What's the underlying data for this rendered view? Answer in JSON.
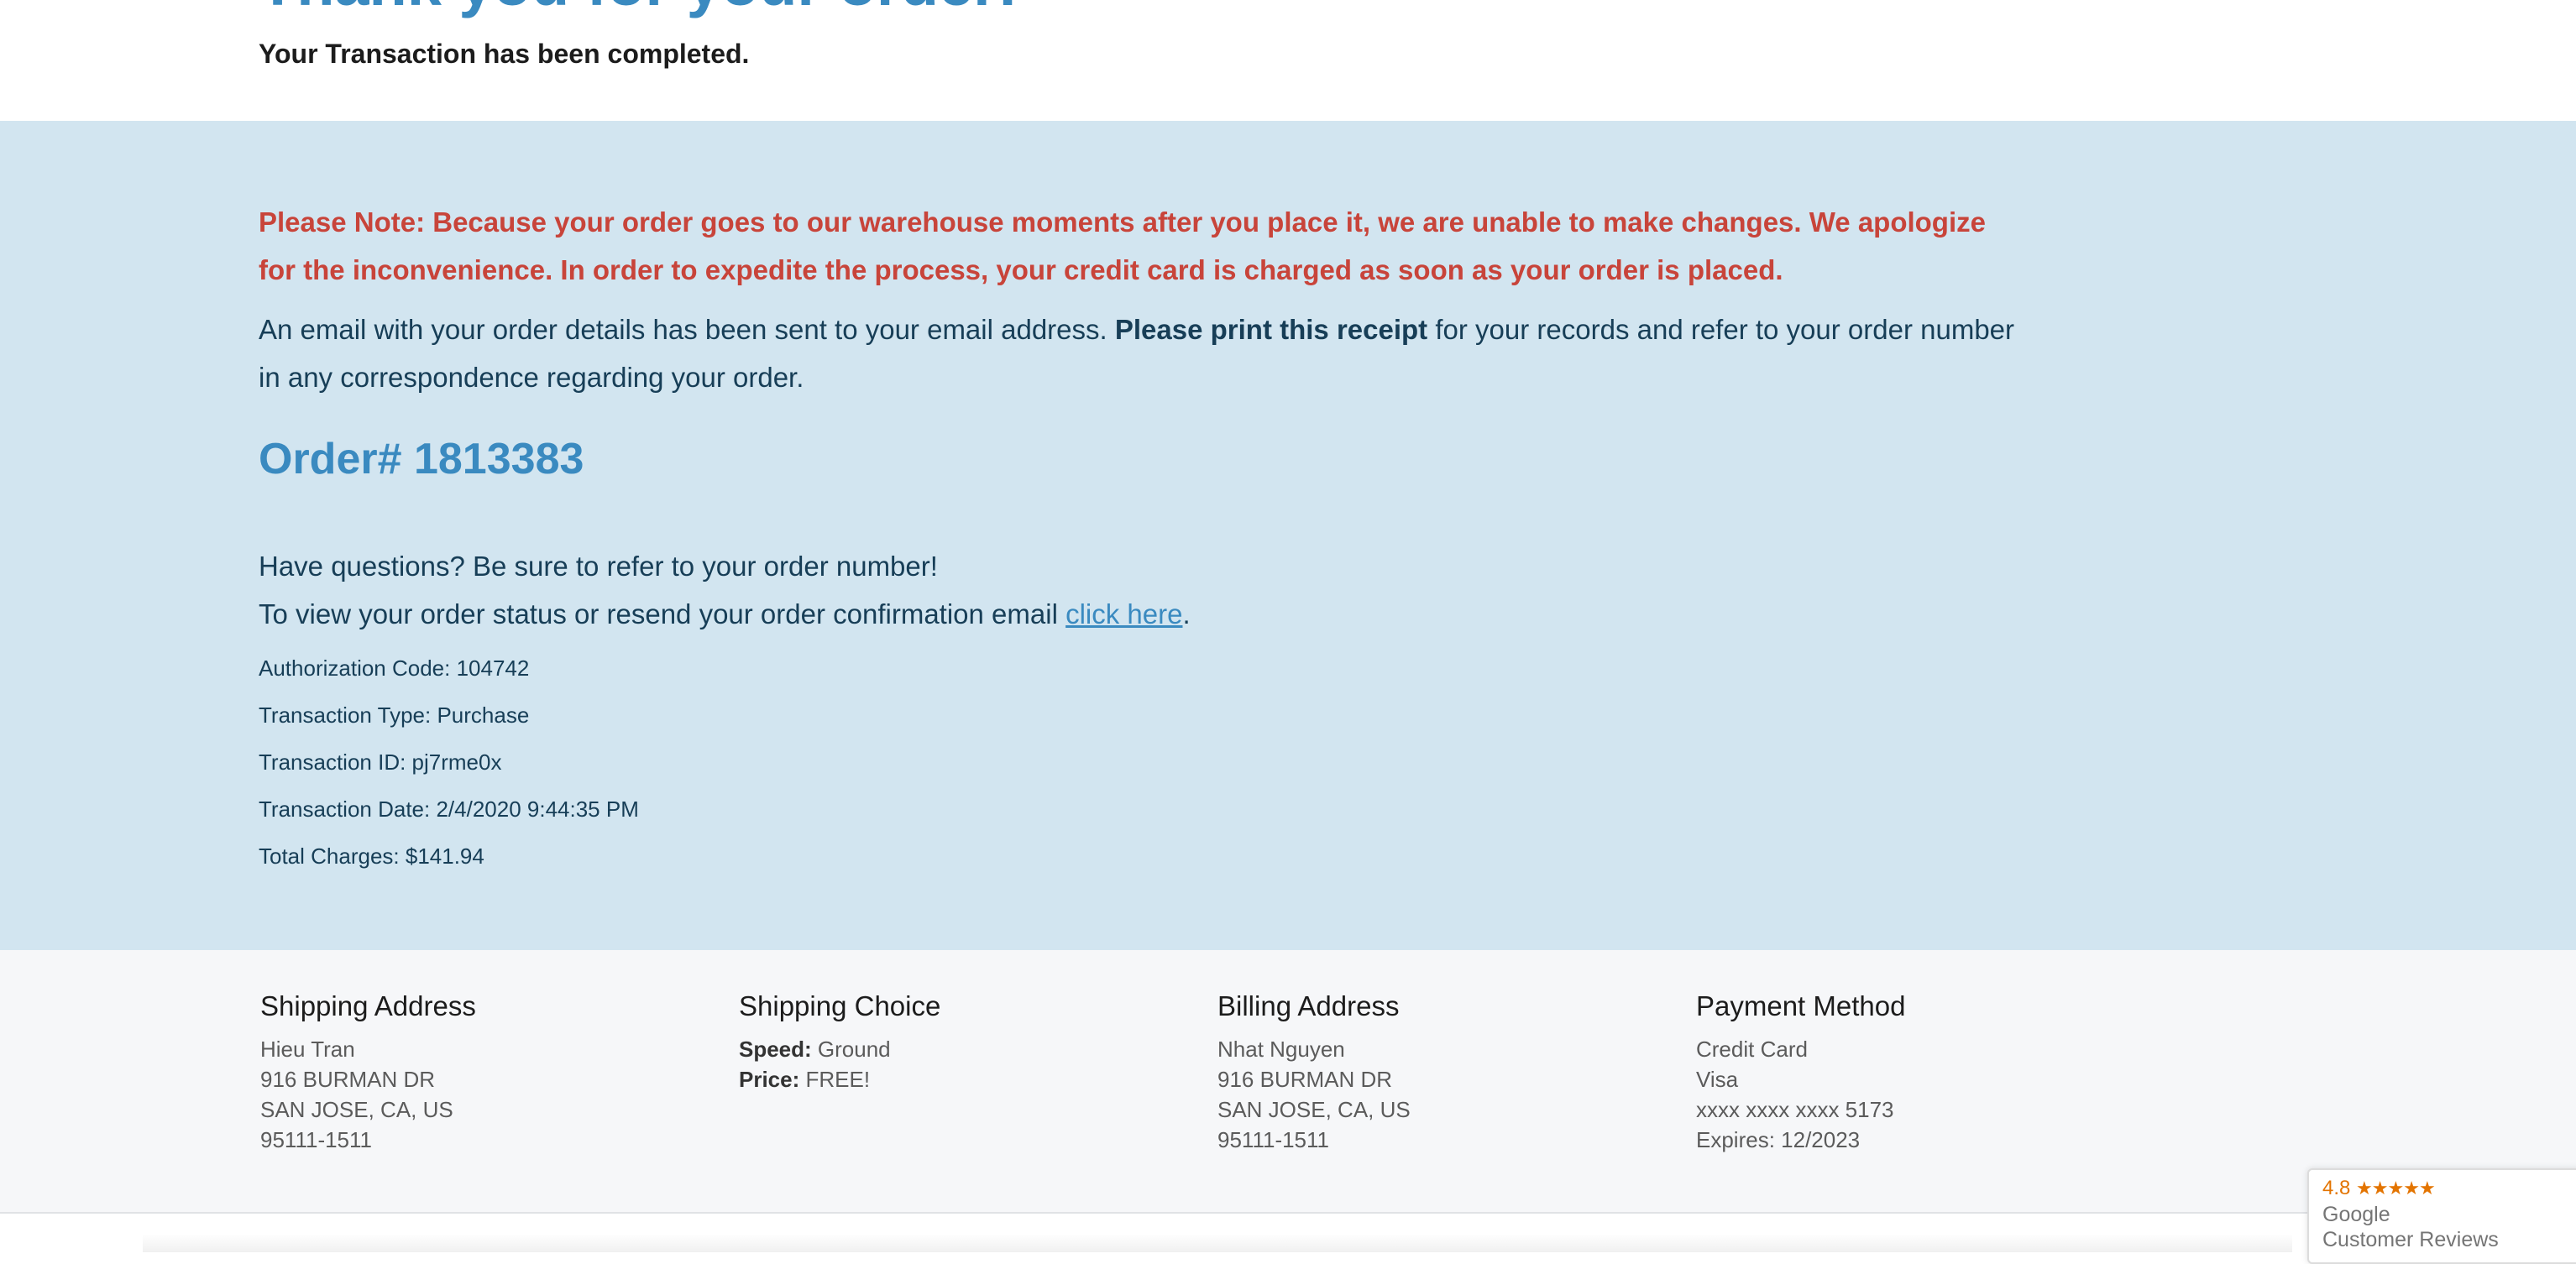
{
  "header": {
    "title": "Thank you for your order!",
    "subtitle": "Your Transaction has been completed."
  },
  "notice": {
    "text": "Please Note: Because your order goes to our warehouse moments after you place it, we are unable to make changes. We apologize for the inconvenience. In order to expedite the process, your credit card is charged as soon as your order is placed."
  },
  "email_message": {
    "part1": "An email with your order details has been sent to your email address.",
    "bold": "Please print this receipt",
    "part2": "for your records and refer to your order number in any correspondence regarding your order."
  },
  "order": {
    "number_label": "Order# 1813383"
  },
  "questions": {
    "line1": "Have questions? Be sure to refer to your order number!",
    "line2_prefix": "To view your order status or resend your order confirmation email",
    "link_label": "click here",
    "line2_suffix": "."
  },
  "transaction": {
    "authorization": "Authorization Code: 104742",
    "type": "Transaction Type: Purchase",
    "id": "Transaction ID: pj7rme0x",
    "date": "Transaction Date: 2/4/2020 9:44:35 PM",
    "total": "Total Charges: $141.94"
  },
  "shipping_address": {
    "heading": "Shipping Address",
    "name": "Hieu Tran",
    "street": "916 BURMAN DR",
    "city": "SAN JOSE, CA, US",
    "zip": "95111-1511"
  },
  "shipping_choice": {
    "heading": "Shipping Choice",
    "speed_label": "Speed:",
    "speed_value": "Ground",
    "price_label": "Price:",
    "price_value": "FREE!"
  },
  "billing_address": {
    "heading": "Billing Address",
    "name": "Nhat Nguyen",
    "street": "916 BURMAN DR",
    "city": "SAN JOSE, CA, US",
    "zip": "95111-1511"
  },
  "payment_method": {
    "heading": "Payment Method",
    "type": "Credit Card",
    "brand": "Visa",
    "card": "xxxx xxxx xxxx 5173",
    "expires": "Expires: 12/2023"
  },
  "reviews_badge": {
    "rating": "4.8",
    "stars": "★★★★★",
    "line1": "Google",
    "line2": "Customer Reviews"
  },
  "colors": {
    "accent": "#3a8ac0",
    "notice": "#c8443a",
    "info_bg": "#d2e5f0",
    "address_bg": "#f6f7f9",
    "star": "#e37400"
  }
}
